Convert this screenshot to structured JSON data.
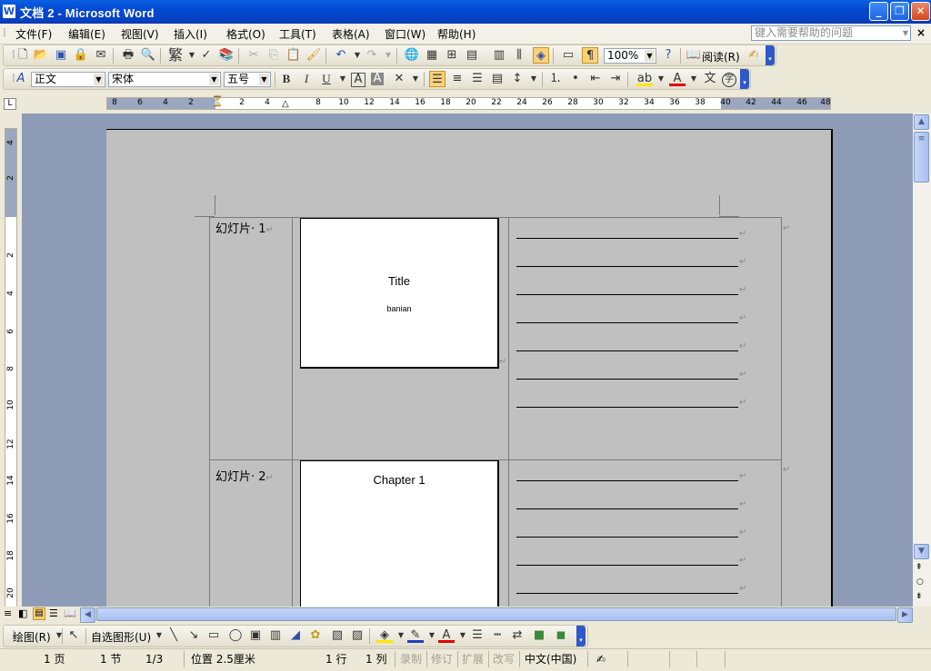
{
  "window": {
    "title": "文档 2 - Microsoft Word",
    "app_icon": "W"
  },
  "menubar": {
    "items": [
      "文件(F)",
      "编辑(E)",
      "视图(V)",
      "插入(I)",
      "格式(O)",
      "工具(T)",
      "表格(A)",
      "窗口(W)",
      "帮助(H)"
    ],
    "help_placeholder": "键入需要帮助的问题",
    "close_doc": "×"
  },
  "std_toolbar": {
    "traditional": "繁",
    "zoom": "100%",
    "read_mode": "阅读(R)"
  },
  "fmt_toolbar": {
    "style": "正文",
    "font": "宋体",
    "size": "五号",
    "bold": "B",
    "italic": "I",
    "underline": "U"
  },
  "hruler": {
    "labels": [
      "8",
      "6",
      "4",
      "2",
      "2",
      "4",
      "8",
      "10",
      "12",
      "14",
      "16",
      "18",
      "20",
      "22",
      "24",
      "26",
      "28",
      "30",
      "32",
      "34",
      "36",
      "38",
      "40",
      "42",
      "44",
      "46",
      "48"
    ]
  },
  "vruler": {
    "labels": [
      "4",
      "2",
      "2",
      "4",
      "6",
      "8",
      "10",
      "12",
      "14",
      "16",
      "18",
      "20"
    ]
  },
  "document": {
    "slides": [
      {
        "label": "幻灯片· 1",
        "title": "Title",
        "subtitle": "banian"
      },
      {
        "label": "幻灯片· 2",
        "title": "Chapter 1",
        "subtitle": ""
      }
    ],
    "para_mark": "↵"
  },
  "drawbar": {
    "draw": "绘图(R)",
    "autoshape": "自选图形(U)"
  },
  "statusbar": {
    "page": "1 页",
    "section": "1 节",
    "pages": "1/3",
    "position": "位置 2.5厘米",
    "line": "1 行",
    "column": "1 列",
    "rec": "录制",
    "trk": "修订",
    "ext": "扩展",
    "ovr": "改写",
    "lang": "中文(中国)"
  }
}
